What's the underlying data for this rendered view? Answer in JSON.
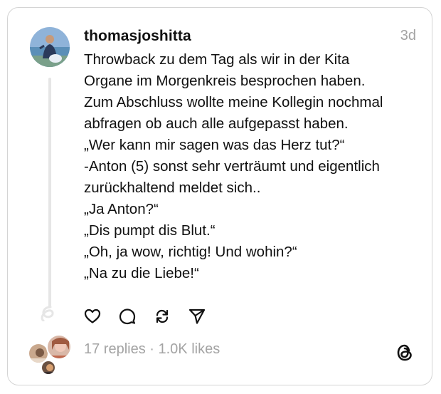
{
  "post": {
    "username": "thomasjoshitta",
    "time": "3d",
    "lines": [
      "Throwback zu dem Tag als wir in der Kita",
      "Organe im Morgenkreis besprochen haben.",
      "Zum Abschluss wollte meine Kollegin nochmal",
      "abfragen ob auch alle aufgepasst haben.",
      "„Wer kann mir sagen was das Herz tut?“",
      "-Anton (5) sonst sehr verträumt und eigentlich",
      "zurückhaltend meldet sich..",
      "„Ja Anton?“",
      "„Dis pumpt dis Blut.“",
      "„Oh, ja wow, richtig! Und wohin?“",
      "„Na zu die Liebe!“"
    ]
  },
  "actions": {
    "icons": [
      "heart-icon",
      "comment-icon",
      "repost-icon",
      "share-icon"
    ]
  },
  "stats": {
    "replies": "17 replies",
    "separator": " · ",
    "likes": "1.0K likes"
  },
  "colors": {
    "text": "#111111",
    "muted": "#a3a3a3",
    "border": "#d4d4d4",
    "thread_line": "#e6e6e6"
  }
}
